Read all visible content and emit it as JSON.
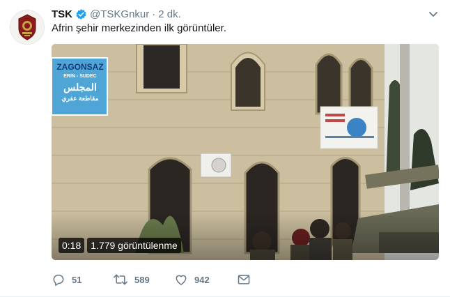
{
  "tweet": {
    "display_name": "TSK",
    "handle": "@TSKGnkur",
    "separator": "·",
    "timestamp": "2 dk.",
    "text": "Afrin şehir merkezinden ilk görüntüler."
  },
  "video": {
    "duration": "0:18",
    "views": "1.779 görüntülenme",
    "sign_left": {
      "title": "ZAGONSAZ",
      "subtitle": "ERIN - SUDEC",
      "arabic_line_1": "المجلس",
      "arabic_line_2": "مقاطعة عفري"
    }
  },
  "actions": {
    "replies": "51",
    "retweets": "589",
    "likes": "942"
  },
  "icons": {
    "verified": "verified-badge-icon",
    "menu": "chevron-down-icon",
    "reply": "reply-icon",
    "retweet": "retweet-icon",
    "like": "heart-icon",
    "message": "envelope-icon"
  },
  "colors": {
    "verified_blue": "#1da1f2",
    "secondary_text": "#657786",
    "primary_text": "#14171a"
  }
}
